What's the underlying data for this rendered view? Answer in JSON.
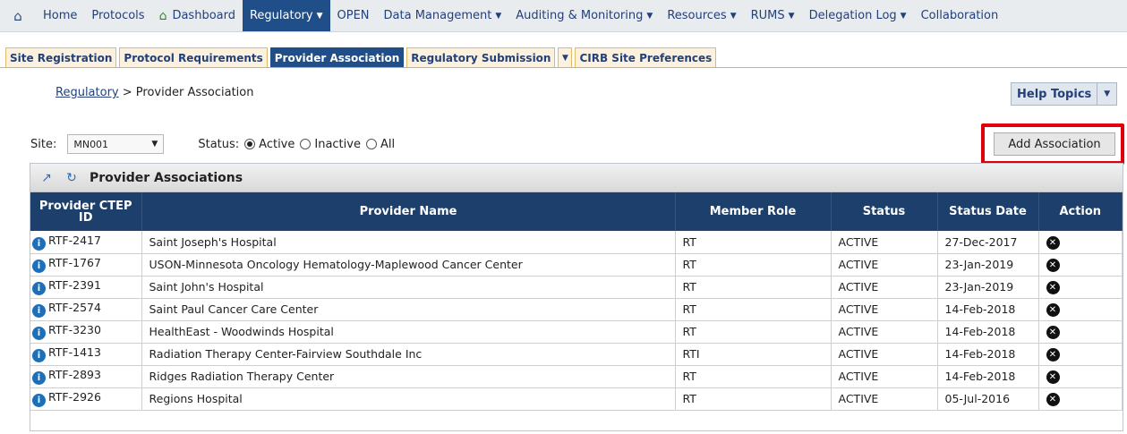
{
  "nav": {
    "items": [
      {
        "label": "Home"
      },
      {
        "label": "Protocols"
      },
      {
        "label": "Dashboard"
      },
      {
        "label": "Regulatory"
      },
      {
        "label": "OPEN"
      },
      {
        "label": "Data Management"
      },
      {
        "label": "Auditing & Monitoring"
      },
      {
        "label": "Resources"
      },
      {
        "label": "RUMS"
      },
      {
        "label": "Delegation Log"
      },
      {
        "label": "Collaboration"
      }
    ]
  },
  "tabs": [
    {
      "label": "Site Registration"
    },
    {
      "label": "Protocol Requirements"
    },
    {
      "label": "Provider Association"
    },
    {
      "label": "Regulatory Submission"
    },
    {
      "label": "CIRB Site Preferences"
    }
  ],
  "breadcrumb": {
    "link": "Regulatory",
    "separator": ">",
    "current": "Provider Association"
  },
  "help": {
    "label": "Help Topics"
  },
  "filters": {
    "site_label": "Site:",
    "site_value": "MN001",
    "status_label": "Status:",
    "options": [
      {
        "label": "Active"
      },
      {
        "label": "Inactive"
      },
      {
        "label": "All"
      }
    ],
    "selected": "Active"
  },
  "add_button": {
    "label": "Add Association"
  },
  "panel": {
    "title": "Provider Associations"
  },
  "table": {
    "headers": {
      "ctep_line1": "Provider CTEP",
      "ctep_line2": "ID",
      "name": "Provider Name",
      "role": "Member Role",
      "status": "Status",
      "date": "Status Date",
      "action": "Action"
    },
    "rows": [
      {
        "id": "RTF-2417",
        "name": "Saint Joseph's Hospital",
        "role": "RT",
        "status": "ACTIVE",
        "date": "27-Dec-2017"
      },
      {
        "id": "RTF-1767",
        "name": "USON-Minnesota Oncology Hematology-Maplewood Cancer Center",
        "role": "RT",
        "status": "ACTIVE",
        "date": "23-Jan-2019"
      },
      {
        "id": "RTF-2391",
        "name": "Saint John's Hospital",
        "role": "RT",
        "status": "ACTIVE",
        "date": "23-Jan-2019"
      },
      {
        "id": "RTF-2574",
        "name": "Saint Paul Cancer Care Center",
        "role": "RT",
        "status": "ACTIVE",
        "date": "14-Feb-2018"
      },
      {
        "id": "RTF-3230",
        "name": "HealthEast - Woodwinds Hospital",
        "role": "RT",
        "status": "ACTIVE",
        "date": "14-Feb-2018"
      },
      {
        "id": "RTF-1413",
        "name": "Radiation Therapy Center-Fairview Southdale Inc",
        "role": "RTI",
        "status": "ACTIVE",
        "date": "14-Feb-2018"
      },
      {
        "id": "RTF-2893",
        "name": "Ridges Radiation Therapy Center",
        "role": "RT",
        "status": "ACTIVE",
        "date": "14-Feb-2018"
      },
      {
        "id": "RTF-2926",
        "name": "Regions Hospital",
        "role": "RT",
        "status": "ACTIVE",
        "date": "05-Jul-2016"
      }
    ]
  }
}
